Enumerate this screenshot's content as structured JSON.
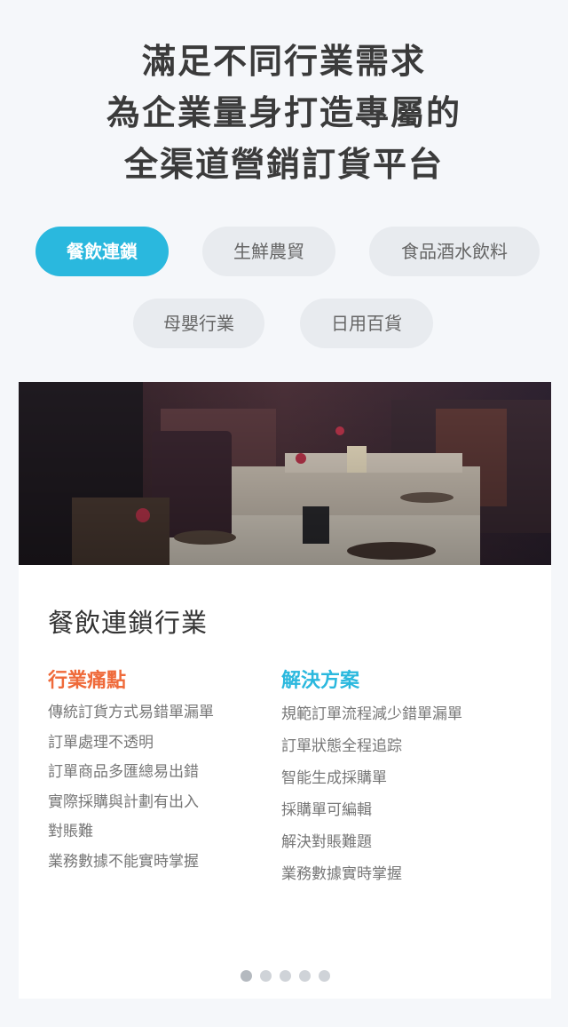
{
  "headline": {
    "line1": "滿足不同行業需求",
    "line2": "為企業量身打造專屬的",
    "line3": "全渠道營銷訂貨平台"
  },
  "tabs": [
    {
      "label": "餐飲連鎖",
      "active": true
    },
    {
      "label": "生鮮農貿",
      "active": false
    },
    {
      "label": "食品酒水飲料",
      "active": false
    },
    {
      "label": "母嬰行業",
      "active": false
    },
    {
      "label": "日用百貨",
      "active": false
    }
  ],
  "card": {
    "title": "餐飲連鎖行業",
    "pain": {
      "heading": "行業痛點",
      "items": [
        "傳統訂貨方式易錯單漏單",
        "訂單處理不透明",
        "訂單商品多匯總易出錯",
        "實際採購與計劃有出入",
        "對賬難",
        "業務數據不能實時掌握"
      ]
    },
    "solution": {
      "heading": "解決方案",
      "items": [
        "規範訂單流程減少錯單漏單",
        "訂單狀態全程追踪",
        "智能生成採購單",
        "採購單可編輯",
        "解決對賬難題",
        "業務數據實時掌握"
      ]
    }
  },
  "carousel": {
    "slide_count": 5,
    "active_index": 0
  },
  "colors": {
    "accent": "#2ab8de",
    "pain_heading": "#ef6a3a",
    "solution_heading": "#2ab8de",
    "background": "#f5f7fa"
  }
}
